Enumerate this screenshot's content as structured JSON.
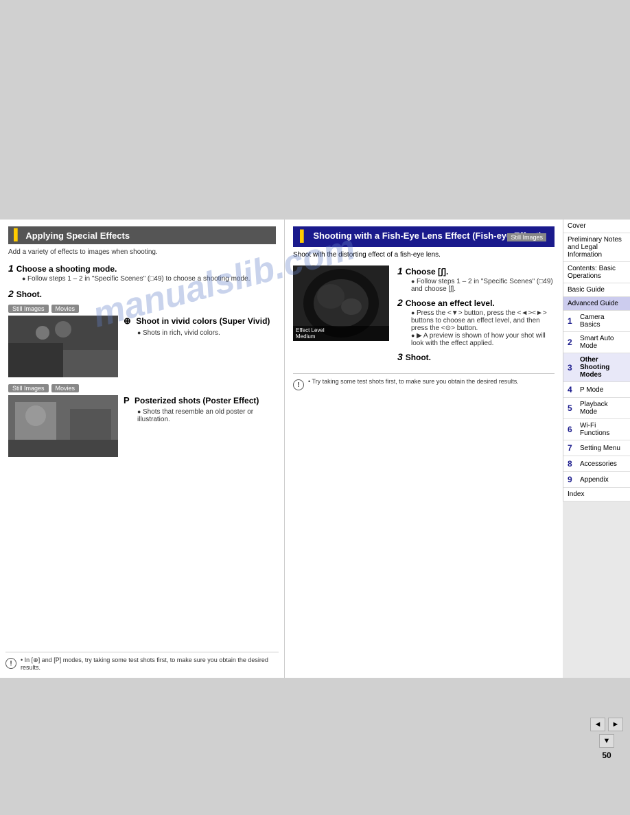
{
  "page": {
    "number": "50",
    "watermark": "manualslib.com"
  },
  "left_section": {
    "title": "Applying Special Effects",
    "subtitle": "Add a variety of effects to images when shooting.",
    "steps": [
      {
        "number": "1",
        "title": "Choose a shooting mode.",
        "desc": "Follow steps 1 – 2 in \"Specific Scenes\" (□49) to choose a shooting mode."
      },
      {
        "number": "2",
        "title": "Shoot.",
        "desc": ""
      }
    ],
    "subsections": [
      {
        "badges": [
          "Still Images",
          "Movies"
        ],
        "icon": "⊕",
        "title": "Shoot in vivid colors (Super Vivid)",
        "bullets": [
          "Shots in rich, vivid colors."
        ]
      },
      {
        "badges": [
          "Still Images",
          "Movies"
        ],
        "icon": "P",
        "title": "Posterized shots (Poster Effect)",
        "bullets": [
          "Shots that resemble an old poster or illustration."
        ]
      }
    ],
    "note": "• In [⊕] and [P] modes, try taking some test shots first, to make sure you obtain the desired results."
  },
  "right_section": {
    "title": "Shooting with a Fish-Eye Lens Effect (Fish-eye Effect)",
    "still_images_badge": "Still Images",
    "intro": "Shoot with the distorting effect of a fish-eye lens.",
    "steps": [
      {
        "number": "1",
        "title": "Choose [ʃ].",
        "bullets": [
          "Follow steps 1 – 2 in \"Specific Scenes\" (□49) and choose [ʃ]."
        ]
      },
      {
        "number": "2",
        "title": "Choose an effect level.",
        "bullets": [
          "Press the <▼> button, press the <◄><►> buttons to choose an effect level, and then press the <⊙> button.",
          "A preview is shown of how your shot will look with the effect applied."
        ]
      },
      {
        "number": "3",
        "title": "Shoot.",
        "bullets": []
      }
    ],
    "image_overlay": {
      "line1": "Effect Level",
      "line2": "Medium"
    },
    "note": "• Try taking some test shots first, to make sure you obtain the desired results."
  },
  "sidebar": {
    "items": [
      {
        "label": "Cover",
        "number": "",
        "active": false
      },
      {
        "label": "Preliminary Notes and Legal Information",
        "number": "",
        "active": false
      },
      {
        "label": "Contents: Basic Operations",
        "number": "",
        "active": false
      },
      {
        "label": "Basic Guide",
        "number": "",
        "active": false
      },
      {
        "label": "Advanced Guide",
        "number": "",
        "active": true
      },
      {
        "label": "Camera Basics",
        "number": "1",
        "active": false
      },
      {
        "label": "Smart Auto Mode",
        "number": "2",
        "active": false
      },
      {
        "label": "Other Shooting Modes",
        "number": "3",
        "active": true
      },
      {
        "label": "P Mode",
        "number": "4",
        "active": false
      },
      {
        "label": "Playback Mode",
        "number": "5",
        "active": false
      },
      {
        "label": "Wi-Fi Functions",
        "number": "6",
        "active": false
      },
      {
        "label": "Setting Menu",
        "number": "7",
        "active": false
      },
      {
        "label": "Accessories",
        "number": "8",
        "active": false
      },
      {
        "label": "Appendix",
        "number": "9",
        "active": false
      },
      {
        "label": "Index",
        "number": "",
        "active": false
      }
    ]
  },
  "nav": {
    "prev": "◄",
    "next": "►",
    "down": "▼"
  }
}
